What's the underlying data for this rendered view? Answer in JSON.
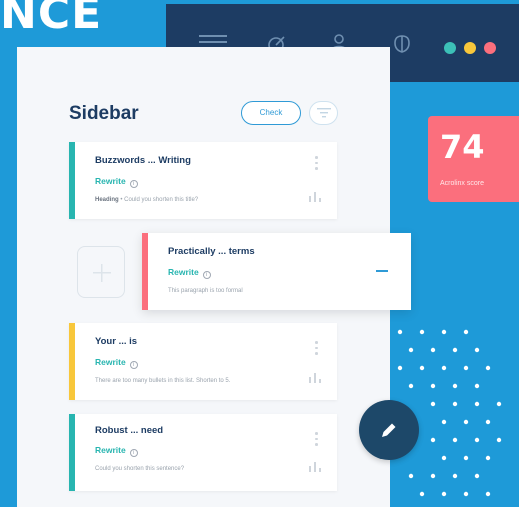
{
  "headline": "NCE",
  "topbar": {
    "icons": [
      "menu-icon",
      "target-icon",
      "person-icon",
      "brain-icon"
    ],
    "dots": [
      "#3cc1b8",
      "#f8c73b",
      "#fb6f7d"
    ]
  },
  "score": {
    "value": "74",
    "label": "Acrolinx score"
  },
  "panel": {
    "title": "Sidebar",
    "check_label": "Check"
  },
  "cards": [
    {
      "title": "Buzzwords ... Writing",
      "action": "Rewrite",
      "desc_prefix": "Heading",
      "desc": " • Could you shorten this title?",
      "color": "#28b5b0"
    },
    {
      "title": "Practically ... terms",
      "action": "Rewrite",
      "desc_prefix": "",
      "desc": "This paragraph is too formal",
      "color": "#fb6f7d"
    },
    {
      "title": "Your ... is",
      "action": "Rewrite",
      "desc_prefix": "",
      "desc": "There are too many bullets in this list. Shorten to 5.",
      "color": "#f8c73b"
    },
    {
      "title": "Robust ... need",
      "action": "Rewrite",
      "desc_prefix": "",
      "desc": "Could you shorten this sentence?",
      "color": "#28b5b0"
    }
  ],
  "colors": {
    "background": "#1e9ad8",
    "navy": "#1d3c63",
    "accent": "#2f9ad6",
    "teal": "#28b5b0"
  }
}
